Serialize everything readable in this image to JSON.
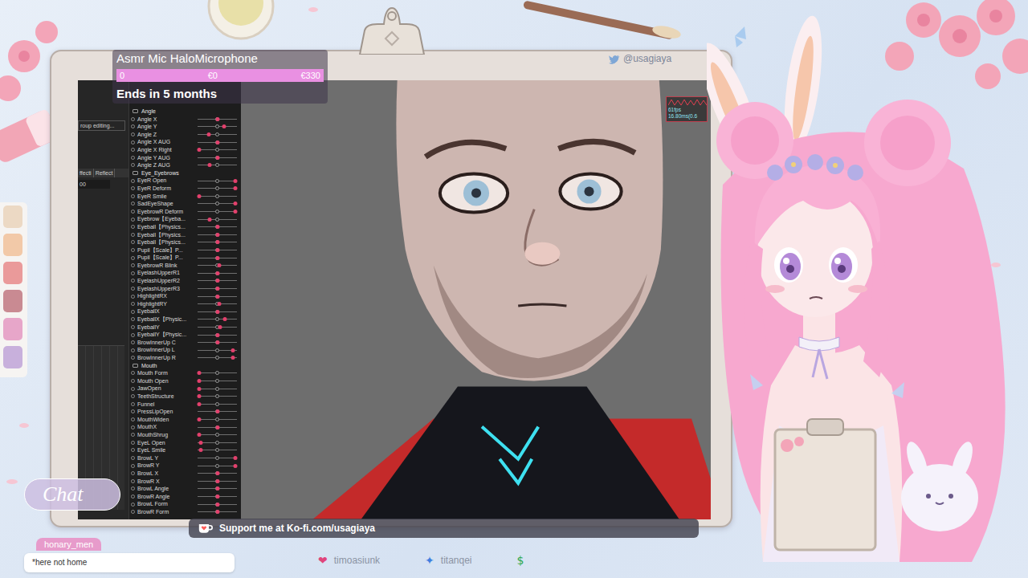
{
  "goal": {
    "title": "Asmr Mic HaloMicrophone",
    "start": "0",
    "current": "€0",
    "target": "€330",
    "level": 0,
    "ends": "Ends in 5 months"
  },
  "social": {
    "handle": "@usagiaya"
  },
  "editor": {
    "sidebar": {
      "group_editing": "roup editing...",
      "effect_label": "ffecti",
      "reflect_label": "Reflect",
      "value": "00"
    },
    "groups": [
      {
        "name": "Angle",
        "params": [
          {
            "name": "Angle X",
            "level": 0.5
          },
          {
            "name": "Angle Y",
            "level": 0.68
          },
          {
            "name": "Angle Z",
            "level": 0.28
          },
          {
            "name": "Angle X AUG",
            "level": 0.5
          },
          {
            "name": "Angle X Right",
            "level": 0.04
          },
          {
            "name": "Angle Y AUG",
            "level": 0.5
          },
          {
            "name": "Angle Z AUG",
            "level": 0.3
          }
        ]
      },
      {
        "name": "Eye_Eyebrows",
        "params": [
          {
            "name": "EyeR Open",
            "level": 0.95
          },
          {
            "name": "EyeR Deform",
            "level": 0.95
          },
          {
            "name": "EyeR Smile",
            "level": 0.04
          },
          {
            "name": "SadEyeShape",
            "level": 0.95
          },
          {
            "name": "EyebrowR Deform",
            "level": 0.95
          },
          {
            "name": "Eyebrow【Eyeba...",
            "level": 0.3
          },
          {
            "name": "Eyeball【Physics...",
            "level": 0.5
          },
          {
            "name": "Eyeball【Physics...",
            "level": 0.5
          },
          {
            "name": "Eyeball【Physics...",
            "level": 0.5
          },
          {
            "name": "Pupil【Scale】P...",
            "level": 0.5
          },
          {
            "name": "Pupil【Scale】P...",
            "level": 0.5
          },
          {
            "name": "EyebrowR Blink",
            "level": 0.55
          },
          {
            "name": "EyelashUpperR1",
            "level": 0.5
          },
          {
            "name": "EyelashUpperR2",
            "level": 0.5
          },
          {
            "name": "EyelashUpperR3",
            "level": 0.5
          },
          {
            "name": "HighlightRX",
            "level": 0.5
          },
          {
            "name": "HighlightRY",
            "level": 0.55
          },
          {
            "name": "EyeballX",
            "level": 0.5
          },
          {
            "name": "EyeballX【Physic...",
            "level": 0.7
          },
          {
            "name": "EyeballY",
            "level": 0.58
          },
          {
            "name": "EyeballY【Physic...",
            "level": 0.5
          },
          {
            "name": "BrowInnerUp C",
            "level": 0.5
          },
          {
            "name": "BrowInnerUp L",
            "level": 0.9
          },
          {
            "name": "BrowInnerUp R",
            "level": 0.9
          }
        ]
      },
      {
        "name": "Mouth",
        "params": [
          {
            "name": "Mouth Form",
            "level": 0.04
          },
          {
            "name": "Mouth Open",
            "level": 0.04
          },
          {
            "name": "JawOpen",
            "level": 0.04
          },
          {
            "name": "TeethStructure",
            "level": 0.04
          },
          {
            "name": "Funnel",
            "level": 0.04
          },
          {
            "name": "PressLipOpen",
            "level": 0.5
          },
          {
            "name": "MouthWiden",
            "level": 0.04
          },
          {
            "name": "MouthX",
            "level": 0.5
          },
          {
            "name": "MouthShrug",
            "level": 0.04
          },
          {
            "name": "EyeL Open",
            "level": 0.08
          },
          {
            "name": "EyeL Smile",
            "level": 0.08
          },
          {
            "name": "BrowL Y",
            "level": 0.95
          },
          {
            "name": "BrowR Y",
            "level": 0.95
          },
          {
            "name": "BrowL X",
            "level": 0.5
          },
          {
            "name": "BrowR X",
            "level": 0.5
          },
          {
            "name": "BrowL Angle",
            "level": 0.5
          },
          {
            "name": "BrowR Angle",
            "level": 0.5
          },
          {
            "name": "BrowL Form",
            "level": 0.5
          },
          {
            "name": "BrowR Form",
            "level": 0.5
          }
        ]
      }
    ],
    "stats": {
      "fps": "61fps",
      "time": "16.80ms(0.6"
    }
  },
  "chat": {
    "title": "Chat",
    "messages": [
      {
        "user": "honary_men",
        "text": "*here not home"
      }
    ]
  },
  "kofi": {
    "text": "Support me at Ko-fi.com/usagiaya"
  },
  "ticker": [
    {
      "icon": "❤",
      "name": "timoasiunk",
      "color": "#e0457b"
    },
    {
      "icon": "✦",
      "name": "titanqei",
      "color": "#3f7fe0"
    },
    {
      "icon": "$",
      "color": "#2fa84f"
    }
  ]
}
